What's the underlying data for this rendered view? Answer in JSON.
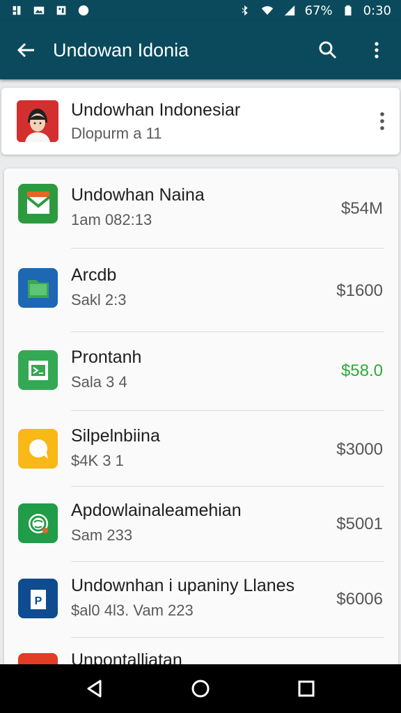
{
  "status_bar": {
    "left_icons": [
      "notification-icon",
      "image-icon",
      "gallery-icon",
      "app-icon"
    ],
    "battery_text": "67%",
    "time": "0:30"
  },
  "app_bar": {
    "title": "Undowan Idonia"
  },
  "header_card": {
    "name": "Undowhan Indonesiar",
    "subtitle": "Dlopurm a 11"
  },
  "list": [
    {
      "name": "Undowhan Naina",
      "sub": "1am 082:13",
      "price": "$54M",
      "icon": "mail-icon",
      "icon_bg": "#2e9a3f",
      "price_color": "#555555"
    },
    {
      "name": "Arcdb",
      "sub": "Sakl 2:3",
      "price": "$1600",
      "icon": "folder-icon",
      "icon_bg": "#1e67b4",
      "price_color": "#555555"
    },
    {
      "name": "Prontanh",
      "sub": "Sala 3 4",
      "price": "$58.0",
      "icon": "sheet-icon",
      "icon_bg": "#34a853",
      "price_color": "#2eaa3c"
    },
    {
      "name": "Silpelnbiina",
      "sub": "$4K 3 1",
      "price": "$3000",
      "icon": "chat-icon",
      "icon_bg": "#f9b817",
      "price_color": "#555555"
    },
    {
      "name": "Apdowlainaleamehian",
      "sub": "Sam 233",
      "price": "$5001",
      "icon": "globe-icon",
      "icon_bg": "#219c48",
      "price_color": "#555555"
    },
    {
      "name": "Undownhan i upaniny Llanes",
      "sub": "$al0 4l3. Vam 223",
      "price": "$6006",
      "icon": "doc-icon",
      "icon_bg": "#0f4c8f",
      "price_color": "#555555"
    },
    {
      "name": "Unpontalliatan",
      "sub": "",
      "price": "",
      "icon": "play-icon",
      "icon_bg": "#e23b26",
      "price_color": "#555555"
    }
  ]
}
